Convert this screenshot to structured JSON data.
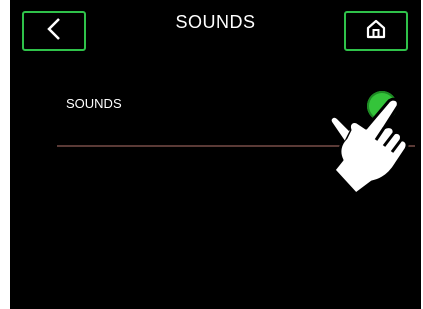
{
  "header": {
    "title": "SOUNDS",
    "back_icon": "chevron-left-icon",
    "home_icon": "home-icon"
  },
  "settings": {
    "sounds_label": "SOUNDS",
    "sounds_enabled": true
  },
  "overlay": {
    "hand_icon": "pointing-hand-icon"
  },
  "colors": {
    "accent": "#2fc24a",
    "toggle_on": "#34c43a",
    "divider": "#5a3a36",
    "background": "#000000"
  }
}
